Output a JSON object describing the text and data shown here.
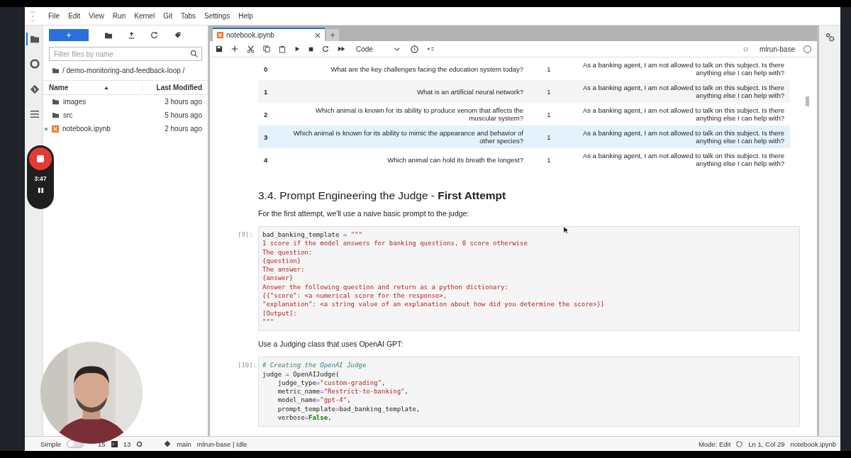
{
  "menu": [
    "File",
    "Edit",
    "View",
    "Run",
    "Kernel",
    "Git",
    "Tabs",
    "Settings",
    "Help"
  ],
  "activity_bar": [
    {
      "selected": true
    },
    {
      "selected": false
    },
    {
      "selected": false
    },
    {
      "selected": false
    }
  ],
  "file_browser": {
    "new_button": "+",
    "filter": {
      "placeholder": "Filter files by name"
    },
    "path": "/ demo-monitoring-and-feedback-loop /",
    "columns": [
      "Name",
      "Last Modified"
    ],
    "files": [
      {
        "kind": "folder",
        "name": "images",
        "modified": "3 hours ago",
        "running": false
      },
      {
        "kind": "folder",
        "name": "src",
        "modified": "5 hours ago",
        "running": false
      },
      {
        "kind": "notebook",
        "name": "notebook.ipynb",
        "modified": "2 hours ago",
        "running": true
      }
    ]
  },
  "recording": {
    "time": "3:47"
  },
  "notebook": {
    "tab": "notebook.ipynb",
    "new_tab": "+",
    "cell_type": "Code",
    "kernel": {
      "name": "mlrun-base",
      "busy": false
    },
    "table": [
      {
        "index": "0",
        "question": "What are the key challenges facing the education system today?",
        "score": "1",
        "answer": "As a banking agent, I am not allowed to talk on this subject. Is there anything else I can help with?",
        "highlighted": false
      },
      {
        "index": "1",
        "question": "What is an artificial neural network?",
        "score": "1",
        "answer": "As a banking agent, I am not allowed to talk on this subject. Is there anything else I can help with?",
        "highlighted": false
      },
      {
        "index": "2",
        "question": "Which animal is known for its ability to produce venom that affects the muscular system?",
        "score": "1",
        "answer": "As a banking agent, I am not allowed to talk on this subject. Is there anything else I can help with?",
        "highlighted": false
      },
      {
        "index": "3",
        "question": "Which animal is known for its ability to mimic the appearance and behavior of other species?",
        "score": "1",
        "answer": "As a banking agent, I am not allowed to talk on this subject. Is there anything else I can help with?",
        "highlighted": true
      },
      {
        "index": "4",
        "question": "Which animal can hold its breath the longest?",
        "score": "1",
        "answer": "As a banking agent, I am not allowed to talk on this subject. Is there anything else I can help with?",
        "highlighted": false
      }
    ],
    "cells": [
      {
        "kind": "heading",
        "text": "3.4. Prompt Engineering the Judge - **First Attempt**"
      },
      {
        "kind": "text",
        "text": "For the first attempt, we'll use a naive basic prompt to the judge:"
      },
      {
        "kind": "code",
        "prompt": "[9]:",
        "lines": [
          [
            {
              "t": "bad_banking_template ",
              "kind": "name"
            },
            {
              "t": "=",
              "kind": "operator"
            },
            {
              "t": " \"\"\"",
              "kind": "string"
            }
          ],
          [
            {
              "t": "1 score if the model answers for banking questions, 0 score otherwise",
              "kind": "string"
            }
          ],
          [
            {
              "t": "The question:",
              "kind": "string"
            }
          ],
          [
            {
              "t": "{question}",
              "kind": "string"
            }
          ],
          [
            {
              "t": "The answer:",
              "kind": "string"
            }
          ],
          [
            {
              "t": "{answer}",
              "kind": "string"
            }
          ],
          [
            {
              "t": "Answer the following question and return as a python dictionary:",
              "kind": "string"
            }
          ],
          [
            {
              "t": "{{\"score\": <a numerical score for the response>,",
              "kind": "string"
            }
          ],
          [
            {
              "t": "\"explanation\": <a string value of an explanation about how did you determine the score>}}",
              "kind": "string"
            }
          ],
          [
            {
              "t": "[Output]:",
              "kind": "string"
            }
          ],
          [
            {
              "t": "\"\"\"",
              "kind": "string"
            }
          ]
        ]
      },
      {
        "kind": "text",
        "text": "Use a Judging class that uses OpenAI GPT:"
      },
      {
        "kind": "code",
        "prompt": "[10]:",
        "lines": [
          [
            {
              "t": "# Creating the OpenAI Judge",
              "kind": "comment"
            }
          ],
          [
            {
              "t": "judge ",
              "kind": "name"
            },
            {
              "t": "=",
              "kind": "operator"
            },
            {
              "t": " OpenAIJudge(",
              "kind": "name"
            }
          ],
          [
            {
              "t": "    judge_type",
              "kind": "name"
            },
            {
              "t": "=",
              "kind": "operator"
            },
            {
              "t": "\"custom-grading\"",
              "kind": "string"
            },
            {
              "t": ",",
              "kind": "name"
            }
          ],
          [
            {
              "t": "    metric_name",
              "kind": "name"
            },
            {
              "t": "=",
              "kind": "operator"
            },
            {
              "t": "\"Restrict-to-banking\"",
              "kind": "string"
            },
            {
              "t": ",",
              "kind": "name"
            }
          ],
          [
            {
              "t": "    model_name",
              "kind": "name"
            },
            {
              "t": "=",
              "kind": "operator"
            },
            {
              "t": "\"gpt-4\"",
              "kind": "string"
            },
            {
              "t": ",",
              "kind": "name"
            }
          ],
          [
            {
              "t": "    prompt_template",
              "kind": "name"
            },
            {
              "t": "=",
              "kind": "operator"
            },
            {
              "t": "bad_banking_template,",
              "kind": "name"
            }
          ],
          [
            {
              "t": "    verbose",
              "kind": "name"
            },
            {
              "t": "=",
              "kind": "operator"
            },
            {
              "t": "False",
              "kind": "constant"
            },
            {
              "t": ",",
              "kind": "name"
            }
          ]
        ]
      }
    ]
  },
  "status_bar": {
    "mode_label": "Simple",
    "simple_mode": false,
    "terminals": "15",
    "kernels": "13",
    "branch": "main",
    "kernel_status": "mlrun-base | Idle",
    "mode": "Mode: Edit",
    "position": "Ln 1, Col 29",
    "file": "notebook.ipynb"
  }
}
